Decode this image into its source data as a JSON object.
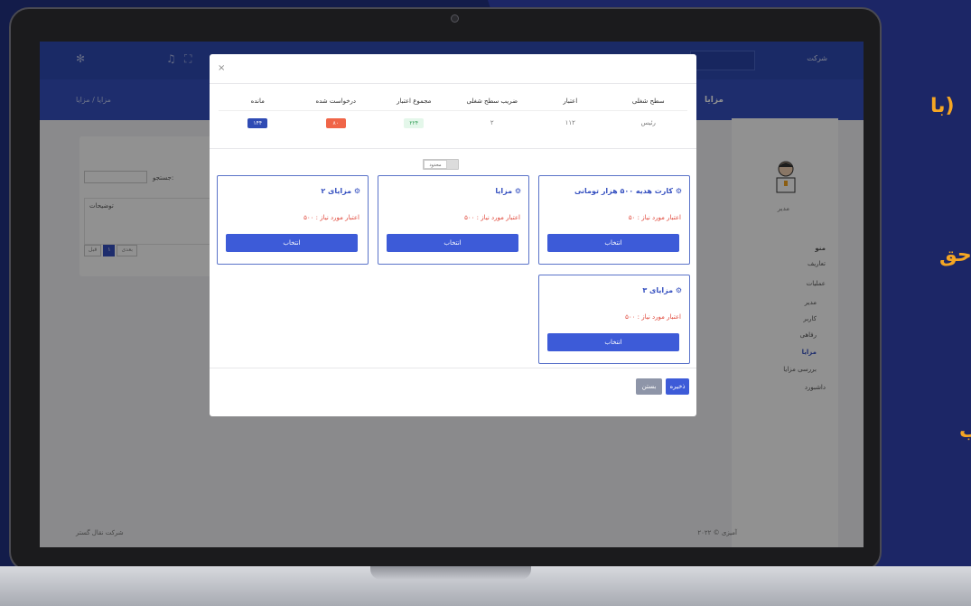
{
  "background": {
    "side_texts": [
      "(با",
      "حق",
      "ب"
    ]
  },
  "app": {
    "company_name": "شرکت",
    "page_title": "مزایا",
    "breadcrumb": "مزایا / مزایا",
    "footer_left": "شرکت نقال گستر",
    "footer_right": "۲۰۲۲ © آمیزی"
  },
  "content": {
    "search_label": "جستجو:",
    "table_header": "توضیحات",
    "pager": [
      "قبل",
      "۱",
      "بعدی"
    ]
  },
  "sidebar": {
    "role": "مدیر",
    "menu_title": "منو",
    "items": [
      {
        "label": "تعاریف",
        "active": false
      },
      {
        "label": "عملیات",
        "active": false
      },
      {
        "label": "مدیر",
        "active": false
      },
      {
        "label": "کاربر",
        "active": false
      },
      {
        "label": "رفاهی",
        "active": false
      },
      {
        "label": "مزایا",
        "active": true
      },
      {
        "label": "بررسی مزایا",
        "active": false
      },
      {
        "label": "داشبورد",
        "active": false
      }
    ]
  },
  "modal": {
    "close_symbol": "×",
    "table": {
      "headers": [
        "سطح شغلی",
        "اعتبار",
        "ضریب سطح شغلی",
        "مجموع اعتبار",
        "درخواست شده",
        "مانده"
      ],
      "row": [
        "رئیس",
        "۱۱۲",
        "۲",
        "۲۲۴",
        "۸۰",
        "۱۴۴"
      ]
    },
    "toggle_label": "محدود",
    "benefits": [
      {
        "title": "کارت هدیه ۵۰۰ هزار تومانی",
        "required": "اعتبار مورد نیاز : ۵۰",
        "button": "انتخاب"
      },
      {
        "title": "مزایا",
        "required": "اعتبار مورد نیاز : ۵۰۰",
        "button": "انتخاب"
      },
      {
        "title": "مزایای ۲",
        "required": "اعتبار مورد نیاز : ۵۰۰",
        "button": "انتخاب"
      },
      {
        "title": "مزایای ۳",
        "required": "اعتبار مورد نیاز : ۵۰۰",
        "button": "انتخاب"
      }
    ],
    "save_label": "ذخیره",
    "close_label": "بستن"
  },
  "colors": {
    "primary": "#3550c0",
    "button": "#3d5bd8",
    "danger_text": "#e0473a",
    "badge_red": "#f06548",
    "badge_green_bg": "#e4f7ea"
  }
}
